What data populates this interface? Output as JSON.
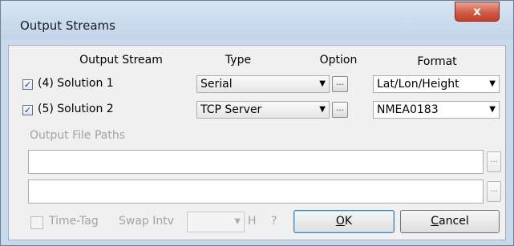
{
  "window": {
    "title": "Output Streams",
    "close_glyph": "x"
  },
  "headers": {
    "stream": "Output Stream",
    "type": "Type",
    "option": "Option",
    "format": "Format"
  },
  "streams": [
    {
      "checked": true,
      "check_glyph": "✓",
      "label": "(4) Solution 1",
      "type": "Serial",
      "option_label": "...",
      "format": "Lat/Lon/Height"
    },
    {
      "checked": true,
      "check_glyph": "✓",
      "label": "(5) Solution 2",
      "type": "TCP Server",
      "option_label": "...",
      "format": "NMEA0183"
    }
  ],
  "file_paths": {
    "label": "Output File Paths",
    "path1": "",
    "path2": "",
    "browse_label": "..."
  },
  "footer": {
    "time_tag_label": "Time-Tag",
    "time_tag_checked": false,
    "swap_label": "Swap Intv",
    "swap_value": "",
    "hours_unit": "H",
    "help": "?",
    "ok_label": "OK",
    "ok_mnemonic": "O",
    "ok_rest": "K",
    "cancel_mnemonic": "C",
    "cancel_rest": "ancel"
  },
  "icons": {
    "dropdown": "chevron-down-icon",
    "close": "close-icon",
    "check": "checkmark-icon"
  }
}
